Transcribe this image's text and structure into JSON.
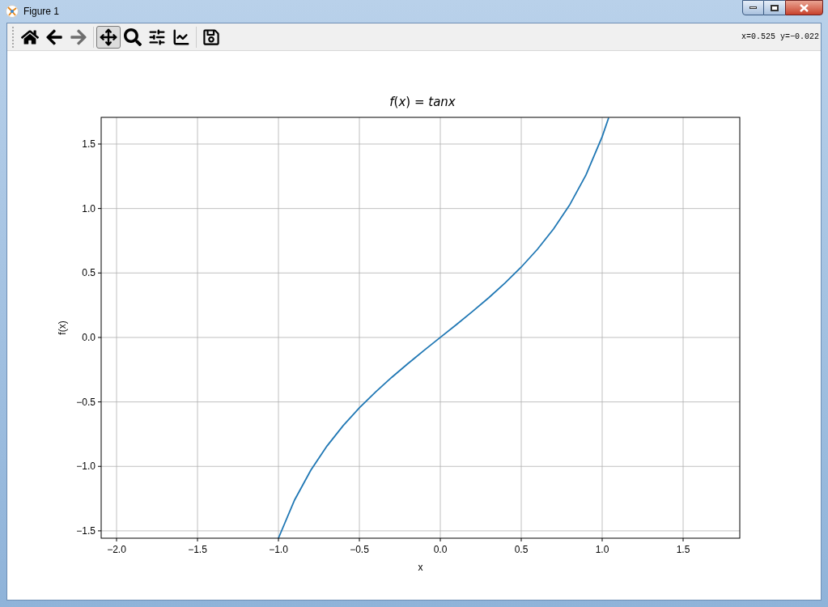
{
  "window": {
    "title": "Figure 1"
  },
  "toolbar": {
    "buttons": [
      {
        "kind": "home",
        "selected": false,
        "disabled": false
      },
      {
        "kind": "back",
        "selected": false,
        "disabled": false
      },
      {
        "kind": "forward",
        "selected": false,
        "disabled": true
      },
      {
        "kind": "pan",
        "selected": true,
        "disabled": false
      },
      {
        "kind": "zoom",
        "selected": false,
        "disabled": false
      },
      {
        "kind": "subplots",
        "selected": false,
        "disabled": false
      },
      {
        "kind": "customize",
        "selected": false,
        "disabled": false
      },
      {
        "kind": "save",
        "selected": false,
        "disabled": false
      }
    ],
    "coordinates": "x=0.525 y=−0.022"
  },
  "figure": {
    "chart_data": {
      "type": "line",
      "title": "*f*(*x*) = *tanx*",
      "xlabel": "x",
      "ylabel": "f(x)",
      "x": [
        -1.0,
        -0.9,
        -0.8,
        -0.7,
        -0.6,
        -0.5,
        -0.4,
        -0.3,
        -0.2,
        -0.1,
        0.0,
        0.1,
        0.2,
        0.3,
        0.4,
        0.5,
        0.6,
        0.7,
        0.8,
        0.9,
        1.0,
        1.04
      ],
      "series": [
        {
          "color": "#1f77b4",
          "values": [
            -1.557,
            -1.26,
            -1.03,
            -0.842,
            -0.684,
            -0.546,
            -0.423,
            -0.309,
            -0.203,
            -0.1,
            0.0,
            0.1,
            0.203,
            0.309,
            0.423,
            0.546,
            0.684,
            0.842,
            1.03,
            1.26,
            1.557,
            1.704
          ]
        }
      ],
      "grid": true,
      "xlim": [
        -2.095,
        1.85
      ],
      "ylim": [
        -1.557,
        1.707
      ],
      "xticks": [
        {
          "value": -2.0,
          "label": "−2.0"
        },
        {
          "value": -1.5,
          "label": "−1.5"
        },
        {
          "value": -1.0,
          "label": "−1.0"
        },
        {
          "value": -0.5,
          "label": "−0.5"
        },
        {
          "value": 0.0,
          "label": "0.0"
        },
        {
          "value": 0.5,
          "label": "0.5"
        },
        {
          "value": 1.0,
          "label": "1.0"
        },
        {
          "value": 1.5,
          "label": "1.5"
        }
      ],
      "yticks": [
        {
          "value": -1.5,
          "label": "−1.5"
        },
        {
          "value": -1.0,
          "label": "−1.0"
        },
        {
          "value": -0.5,
          "label": "−0.5"
        },
        {
          "value": 0.0,
          "label": "0.0"
        },
        {
          "value": 0.5,
          "label": "0.5"
        },
        {
          "value": 1.0,
          "label": "1.0"
        },
        {
          "value": 1.5,
          "label": "1.5"
        }
      ]
    }
  }
}
